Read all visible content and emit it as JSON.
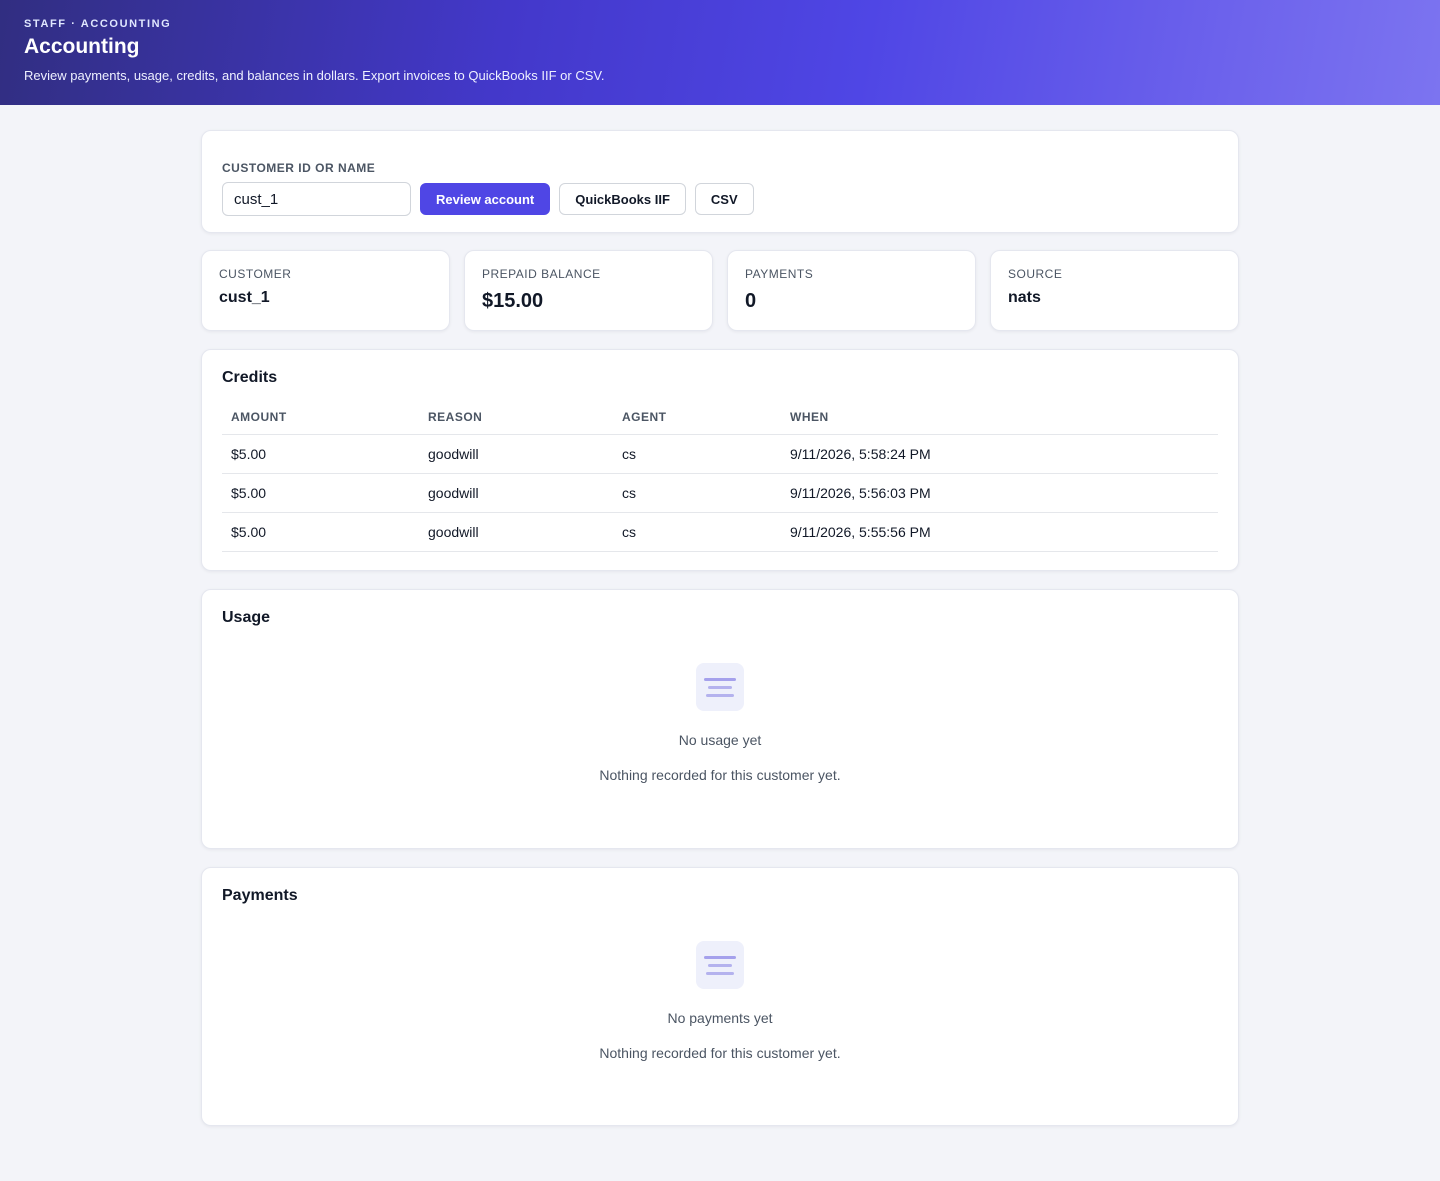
{
  "header": {
    "eyebrow": "STAFF · ACCOUNTING",
    "title": "Accounting",
    "subtitle": "Review payments, usage, credits, and balances in dollars. Export invoices to QuickBooks IIF or CSV."
  },
  "search": {
    "label": "CUSTOMER ID OR NAME",
    "value": "cust_1",
    "review_label": "Review account",
    "quickbooks_label": "QuickBooks IIF",
    "csv_label": "CSV"
  },
  "stats": {
    "customer": {
      "label": "CUSTOMER",
      "value": "cust_1"
    },
    "prepaid": {
      "label": "PREPAID BALANCE",
      "value": "$15.00"
    },
    "payments": {
      "label": "PAYMENTS",
      "value": "0"
    },
    "source": {
      "label": "SOURCE",
      "value": "nats"
    }
  },
  "credits": {
    "title": "Credits",
    "columns": [
      "AMOUNT",
      "REASON",
      "AGENT",
      "WHEN"
    ],
    "rows": [
      [
        "$5.00",
        "goodwill",
        "cs",
        "9/11/2026, 5:58:24 PM"
      ],
      [
        "$5.00",
        "goodwill",
        "cs",
        "9/11/2026, 5:56:03 PM"
      ],
      [
        "$5.00",
        "goodwill",
        "cs",
        "9/11/2026, 5:55:56 PM"
      ]
    ]
  },
  "usage": {
    "title": "Usage",
    "empty_icon": "list-icon",
    "empty_title": "No usage yet",
    "empty_sub": "Nothing recorded for this customer yet."
  },
  "payments": {
    "title": "Payments",
    "empty_icon": "list-icon",
    "empty_title": "No payments yet",
    "empty_sub": "Nothing recorded for this customer yet."
  },
  "colors": {
    "accent": "#4f46e5",
    "page_bg": "#f3f4f9"
  }
}
